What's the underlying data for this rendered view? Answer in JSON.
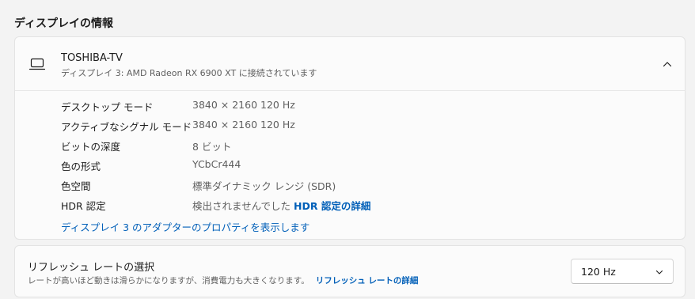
{
  "section_title": "ディスプレイの情報",
  "device": {
    "name": "TOSHIBA-TV",
    "subtitle": "ディスプレイ 3: AMD Radeon RX 6900 XT に接続されています",
    "icon": "monitor-icon",
    "expanded": true
  },
  "rows": [
    {
      "label": "デスクトップ モード",
      "value": "3840 × 2160 120 Hz"
    },
    {
      "label": "アクティブなシグナル モード",
      "value": "3840 × 2160 120 Hz"
    },
    {
      "label": "ビットの深度",
      "value": "8 ビット"
    },
    {
      "label": "色の形式",
      "value": "YCbCr444"
    },
    {
      "label": "色空間",
      "value": "標準ダイナミック レンジ (SDR)"
    },
    {
      "label": "HDR 認定",
      "value": "検出されませんでした",
      "link": "HDR 認定の詳細"
    }
  ],
  "adapter_link": "ディスプレイ 3 のアダプターのプロパティを表示します",
  "refresh": {
    "title": "リフレッシュ レートの選択",
    "description": "レートが高いほど動きは滑らかになりますが、消費電力も大きくなります。",
    "link": "リフレッシュ レートの詳細",
    "selected": "120 Hz"
  },
  "colors": {
    "accent": "#005fb8",
    "background": "#f3f3f3",
    "card": "#fbfbfb"
  }
}
